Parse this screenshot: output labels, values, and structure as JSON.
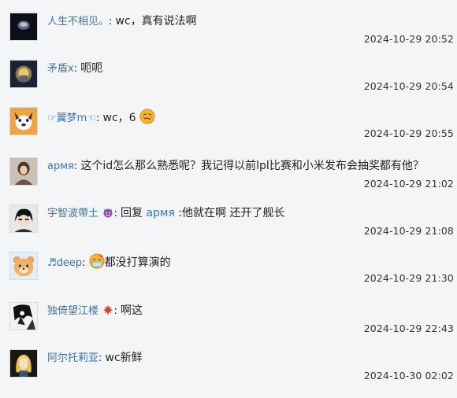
{
  "comments": [
    {
      "user": "人生不相见。",
      "colon": ": ",
      "text": "wc，真有说法啊",
      "time": "2024-10-29 20:52"
    },
    {
      "user": "矛盾x",
      "colon": ": ",
      "text": "呃呃",
      "time": "2024-10-29 20:54"
    },
    {
      "user_prefix": "☞",
      "user": "翼梦m",
      "user_suffix": "☜",
      "colon": ": ",
      "text": "wc，6",
      "time": "2024-10-29 20:55"
    },
    {
      "user": "армя",
      "colon": ": ",
      "text": "这个id怎么那么熟悉呢？我记得以前lpl比赛和小米发布会抽奖都有他？",
      "time": "2024-10-29 21:02"
    },
    {
      "user": "宇智波帶土",
      "colon": ": ",
      "text_prefix": "回复 ",
      "mention": "армя",
      "text": " :他就在啊 还开了舰长",
      "time": "2024-10-29 21:08"
    },
    {
      "user_prefix": "♬",
      "user": "deep",
      "colon": ": ",
      "text": "都没打算演的",
      "time": "2024-10-29 21:30"
    },
    {
      "user": "独倚望江楼",
      "colon": ": ",
      "text": "啊这",
      "time": "2024-10-29 22:43"
    },
    {
      "user": "阿尔托莉亚",
      "colon": ": ",
      "text": "wc新鲜",
      "time": "2024-10-30 02:02"
    }
  ],
  "icons": {
    "smirk_emoji": "smirk-face-icon",
    "devil_emoji": "purple-devil-icon",
    "sick_emoji": "sick-face-icon",
    "leaf_emoji": "maple-leaf-icon"
  },
  "colors": {
    "username": "#3d74b5",
    "background": "#f4f5f7"
  }
}
